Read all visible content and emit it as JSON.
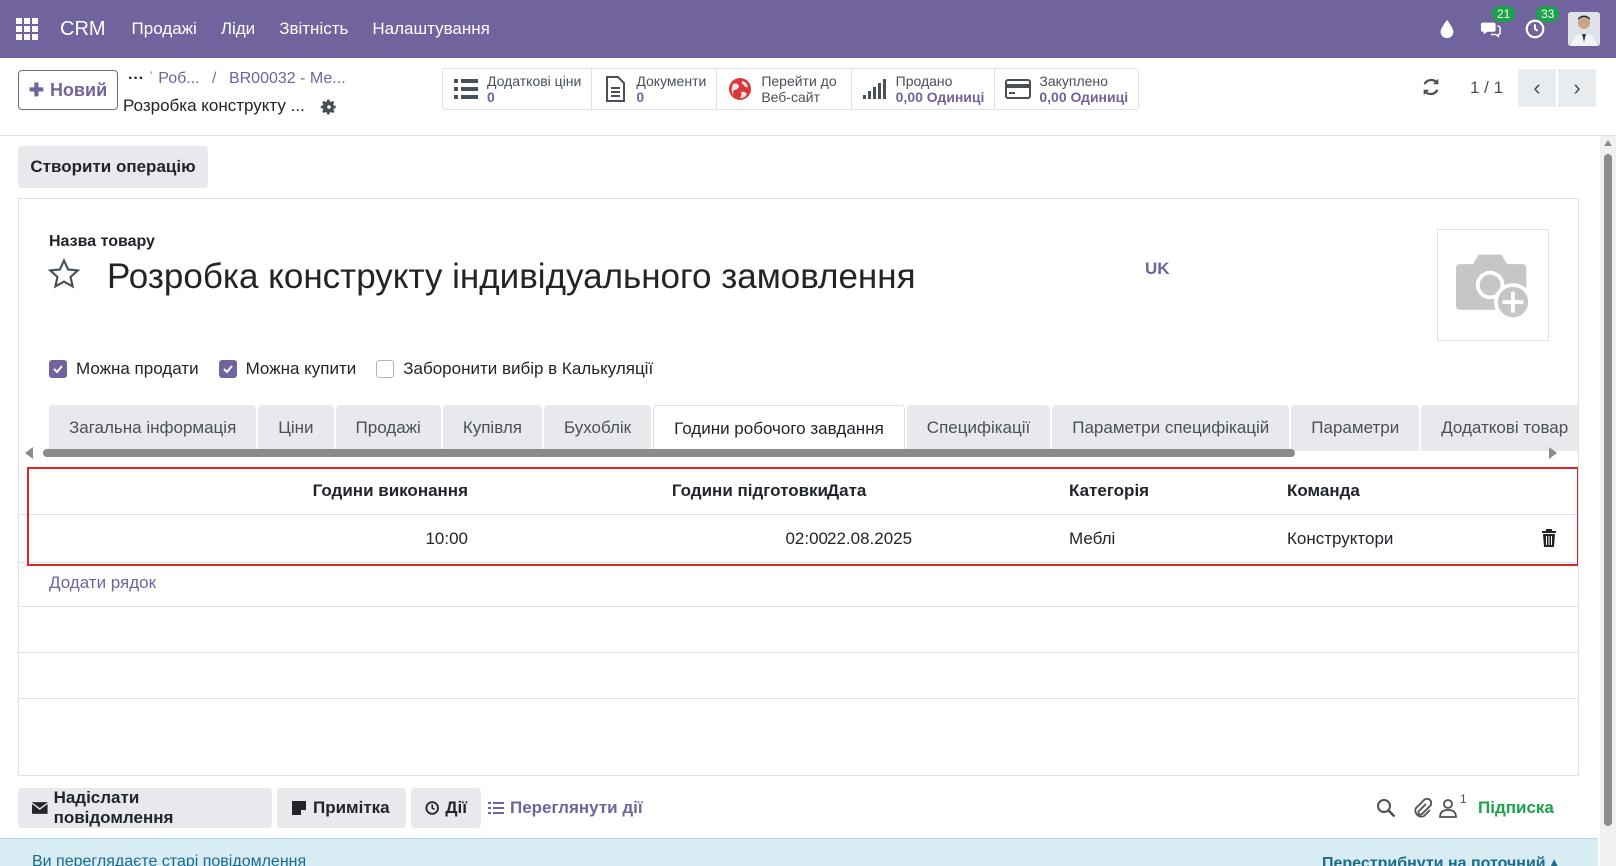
{
  "navbar": {
    "brand": "CRM",
    "menu": [
      "Продажі",
      "Ліди",
      "Звітність",
      "Налаштування"
    ],
    "messages_count": "21",
    "activities_count": "33"
  },
  "control_panel": {
    "new_label": "Новий",
    "breadcrumb": [
      "Роб...",
      "BR00032 - Ме..."
    ],
    "current_record": "Розробка конструкту ...",
    "stat_buttons": [
      {
        "title": "Додаткові ціни",
        "value": "0",
        "icon": "list-icon"
      },
      {
        "title": "Документи",
        "value": "0",
        "icon": "document-icon"
      },
      {
        "title": "Перейти до",
        "value": "Веб-сайт",
        "icon": "globe-icon"
      },
      {
        "title": "Продано",
        "value": "0,00 Одиниці",
        "icon": "signal-icon"
      },
      {
        "title": "Закуплено",
        "value": "0,00 Одиниці",
        "icon": "credit-card-icon"
      }
    ],
    "pager": "1 / 1"
  },
  "form": {
    "create_operation": "Створити операцію",
    "name_label": "Назва товару",
    "title": "Розробка конструкту індивідуального замовлення",
    "lang": "UK",
    "checkboxes": [
      {
        "label": "Можна продати",
        "checked": true
      },
      {
        "label": "Можна купити",
        "checked": true
      },
      {
        "label": "Заборонити вибір в Калькуляції",
        "checked": false
      }
    ],
    "tabs": [
      "Загальна інформація",
      "Ціни",
      "Продажі",
      "Купівля",
      "Бухоблік",
      "Години робочого завдання",
      "Специфікації",
      "Параметри специфікацій",
      "Параметри",
      "Додаткові товар"
    ],
    "active_tab": "Години робочого завдання",
    "table": {
      "headers": [
        "Години виконання",
        "Години підготовки",
        "Дата",
        "Категорія",
        "Команда"
      ],
      "rows": [
        [
          "10:00",
          "02:00",
          "22.08.2025",
          "Меблі",
          "Конструктори"
        ]
      ],
      "add_line": "Додати рядок"
    }
  },
  "chatter": {
    "send_message": "Надіслати повідомлення",
    "note": "Примітка",
    "activities": "Дії",
    "view_activities": "Переглянути дії",
    "followers_count": "1",
    "subscribe": "Підписка",
    "old_messages": "Ви переглядаєте старі повідомлення",
    "jump_to_current": "Перестрибнути на поточний"
  },
  "colors": {
    "brand": "#71639e",
    "success": "#1aa34a",
    "highlight": "#e02424"
  }
}
